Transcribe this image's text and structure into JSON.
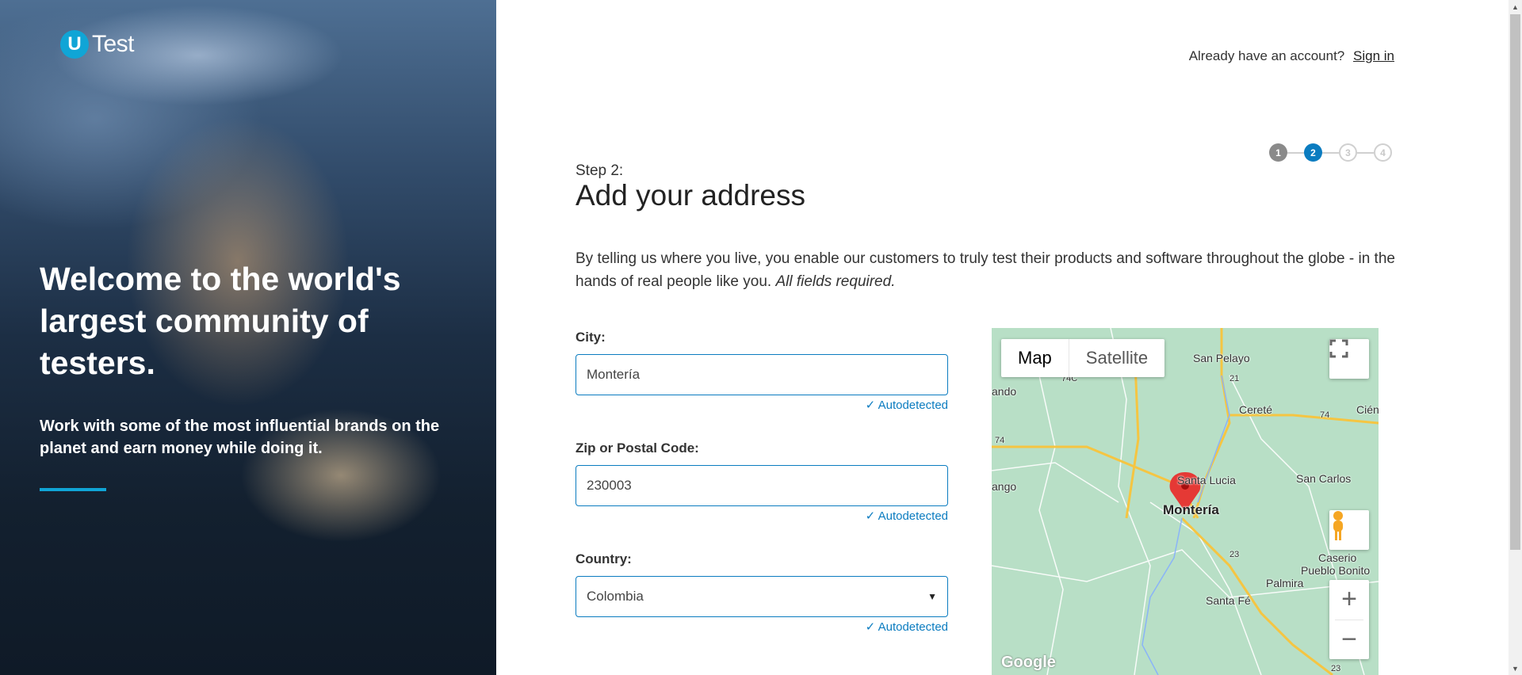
{
  "brand": {
    "logo_mark": "U",
    "logo_text": "Test"
  },
  "hero": {
    "headline": "Welcome to the world's largest community of testers.",
    "subtext": "Work with some of the most influential brands on the planet and earn money while doing it."
  },
  "header": {
    "account_prompt": "Already have an account?",
    "sign_in": "Sign in"
  },
  "steps": {
    "items": [
      "1",
      "2",
      "3",
      "4"
    ],
    "current": 2
  },
  "form": {
    "step_label": "Step 2:",
    "title": "Add your address",
    "intro": "By telling us where you live, you enable our customers to truly test their products and software throughout the globe - in the hands of real people like you.",
    "intro_note": "All fields required.",
    "city": {
      "label": "City:",
      "value": "Montería",
      "status": "Autodetected"
    },
    "zip": {
      "label": "Zip or Postal Code:",
      "value": "230003",
      "status": "Autodetected"
    },
    "country": {
      "label": "Country:",
      "value": "Colombia",
      "status": "Autodetected"
    }
  },
  "map": {
    "type_map": "Map",
    "type_satellite": "Satellite",
    "zoom_in": "+",
    "zoom_out": "−",
    "logo": "Google",
    "labels": {
      "city": "Montería",
      "san_pelayo": "San Pelayo",
      "cerete": "Cereté",
      "cienaga": "Ciénaga de Oro",
      "santa_lucia": "Santa Lucia",
      "san_carlos": "San Carlos",
      "caserio": "Caserio",
      "pueblo_bonito": "Pueblo Bonito",
      "palmira": "Palmira",
      "santa_fe": "Santa Fé",
      "ando": "ando",
      "ango": "ango",
      "r74c": "74C",
      "r21": "21",
      "r74": "74",
      "r74b": "74",
      "r23": "23",
      "r23b": "23"
    },
    "icons": [
      "fullscreen-icon",
      "pegman-icon",
      "map-marker-icon"
    ]
  },
  "colors": {
    "accent": "#0b7cc0",
    "brand": "#10a5d6",
    "map_land": "#b8dfc6",
    "road": "#f5c542",
    "marker": "#e53935"
  }
}
